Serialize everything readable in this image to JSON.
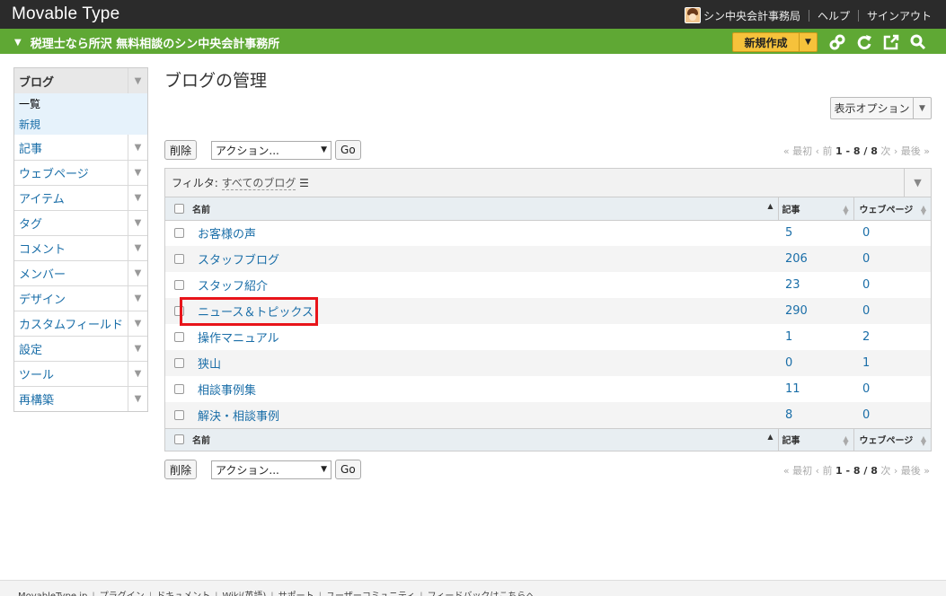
{
  "app": {
    "title": "Movable Type"
  },
  "topnav": {
    "user": "シン中央会計事務局",
    "help": "ヘルプ",
    "signout": "サインアウト"
  },
  "greenbar": {
    "site_title": "税理士なら所沢 無料相談のシン中央会計事務所",
    "new_button": "新規作成"
  },
  "sidebar": {
    "header": "ブログ",
    "sub": [
      "一覧",
      "新規"
    ],
    "items": [
      "記事",
      "ウェブページ",
      "アイテム",
      "タグ",
      "コメント",
      "メンバー",
      "デザイン",
      "カスタムフィールド",
      "設定",
      "ツール",
      "再構築"
    ]
  },
  "page": {
    "title": "ブログの管理",
    "display_options": "表示オプション"
  },
  "actions": {
    "delete": "削除",
    "action_select": "アクション...",
    "go": "Go"
  },
  "pager": {
    "first": "« 最初",
    "prev": "‹ 前",
    "range": "1 - 8 / 8",
    "next": "次 ›",
    "last": "最後 »"
  },
  "filter": {
    "label": "フィルタ:",
    "value": "すべてのブログ"
  },
  "table": {
    "headers": {
      "name": "名前",
      "entries": "記事",
      "pages": "ウェブページ"
    },
    "rows": [
      {
        "name": "お客様の声",
        "entries": "5",
        "pages": "0"
      },
      {
        "name": "スタッフブログ",
        "entries": "206",
        "pages": "0"
      },
      {
        "name": "スタッフ紹介",
        "entries": "23",
        "pages": "0"
      },
      {
        "name": "ニュース＆トピックス",
        "entries": "290",
        "pages": "0"
      },
      {
        "name": "操作マニュアル",
        "entries": "1",
        "pages": "2"
      },
      {
        "name": "狭山",
        "entries": "0",
        "pages": "1"
      },
      {
        "name": "相談事例集",
        "entries": "11",
        "pages": "0"
      },
      {
        "name": "解決・相談事例",
        "entries": "8",
        "pages": "0"
      }
    ]
  },
  "footer": [
    "MovableType.jp",
    "プラグイン",
    "ドキュメント",
    "Wiki(英語)",
    "サポート",
    "ユーザーコミュニティ",
    "フィードバックはこちらへ"
  ],
  "colors": {
    "topbar": "#2b2b2b",
    "greenbar": "#5fa834",
    "new_button": "#f6c23b",
    "highlight": "#e8141a",
    "link": "#1a6ea8"
  }
}
